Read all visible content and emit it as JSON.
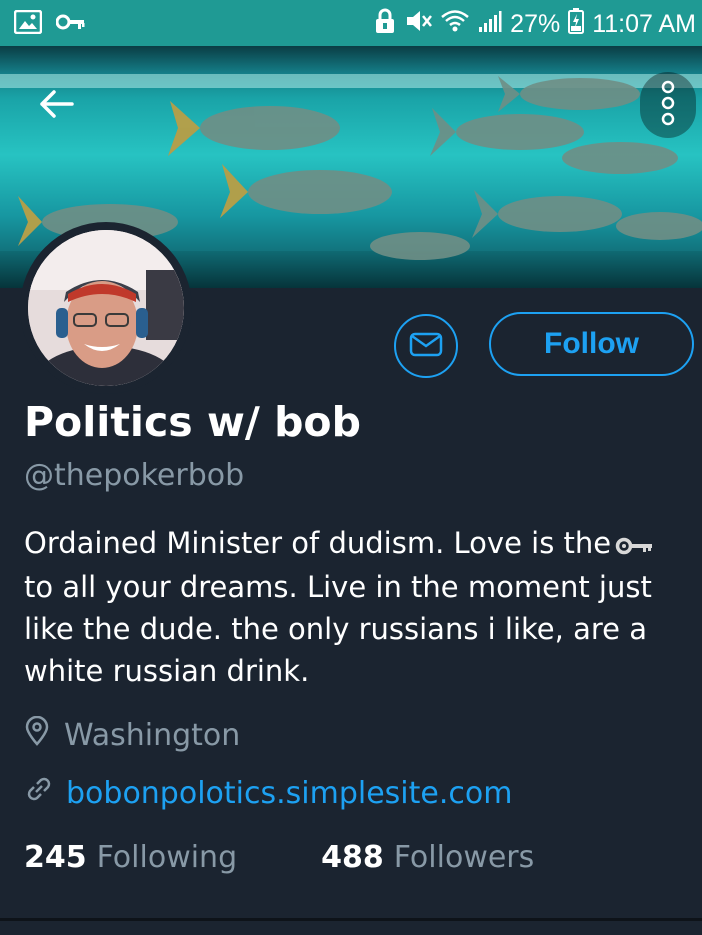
{
  "status_bar": {
    "battery_percent": "27%",
    "time": "11:07 AM",
    "left_icons": [
      "image-icon",
      "key-icon"
    ],
    "right_icons": [
      "lock-icon",
      "mute-icon",
      "wifi-icon",
      "signal-icon",
      "battery-icon"
    ]
  },
  "profile": {
    "display_name": "Politics w/ bob",
    "handle": "@thepokerbob",
    "bio_lines": [
      "Ordained Minister of dudism. Love is the",
      "to all your dreams. Live in the moment just",
      "like the dude. the only russians i like, are a",
      "white russian drink."
    ],
    "bio_inline_icon": "key-icon",
    "location": "Washington",
    "website": "bobonpolotics.simplesite.com",
    "following_count": "245",
    "following_label": "Following",
    "followers_count": "488",
    "followers_label": "Followers"
  },
  "actions": {
    "follow_label": "Follow",
    "message_icon": "envelope-icon",
    "back_icon": "back-arrow-icon",
    "more_icon": "more-vertical-icon"
  },
  "colors": {
    "status_bar": "#1f9a94",
    "background": "#1b2430",
    "accent": "#1da1f2",
    "muted_text": "#8899a6"
  }
}
